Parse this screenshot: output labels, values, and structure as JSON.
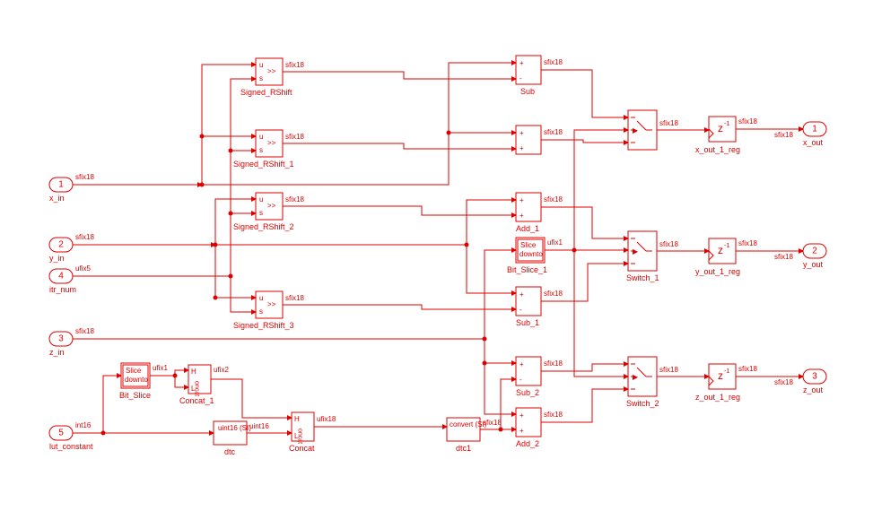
{
  "signals": {
    "sfix18": "sfix18",
    "ufix5": "ufix5",
    "ufix1": "ufix1",
    "ufix2": "ufix2",
    "ufix18": "ufix18",
    "uint16": "uint16",
    "int16": "int16"
  },
  "ports": {
    "x_in": {
      "num": "1",
      "label": "x_in"
    },
    "y_in": {
      "num": "2",
      "label": "y_in"
    },
    "z_in": {
      "num": "3",
      "label": "z_in"
    },
    "itr_num": {
      "num": "4",
      "label": "itr_num"
    },
    "lut_constant": {
      "num": "5",
      "label": "lut_constant"
    },
    "x_out": {
      "num": "1",
      "label": "x_out"
    },
    "y_out": {
      "num": "2",
      "label": "y_out"
    },
    "z_out": {
      "num": "3",
      "label": "z_out"
    }
  },
  "blocks": {
    "rshift": [
      "Signed_RShift",
      "Signed_RShift_1",
      "Signed_RShift_2",
      "Signed_RShift_3"
    ],
    "sub": [
      "Sub",
      "Sub_1",
      "Sub_2"
    ],
    "add": [
      "Add_1",
      "Add_2"
    ],
    "switch": [
      "Switch_1",
      "Switch_2"
    ],
    "delay": [
      "x_out_1_reg",
      "y_out_1_reg",
      "z_out_1_reg"
    ],
    "bitslice": [
      "Bit_Slice",
      "Bit_Slice_1"
    ],
    "concat": [
      "Concat_1",
      "Concat"
    ],
    "dtc": [
      "dtc",
      "dtc1"
    ]
  },
  "text": {
    "shift_u": "u",
    "shift_s": "s",
    "shift_arrow": ">>",
    "z1": "z",
    "neg1": "-1",
    "slice": "Slice",
    "downto": "downto",
    "concat_h": "H",
    "concat_l": "L",
    "concat_word": "oncat",
    "dtc_uint": "uint16\n(SI)",
    "dtc_cvt": "convert\n(SI)",
    "plus": "+",
    "minus": "-",
    "tri": "▶"
  }
}
